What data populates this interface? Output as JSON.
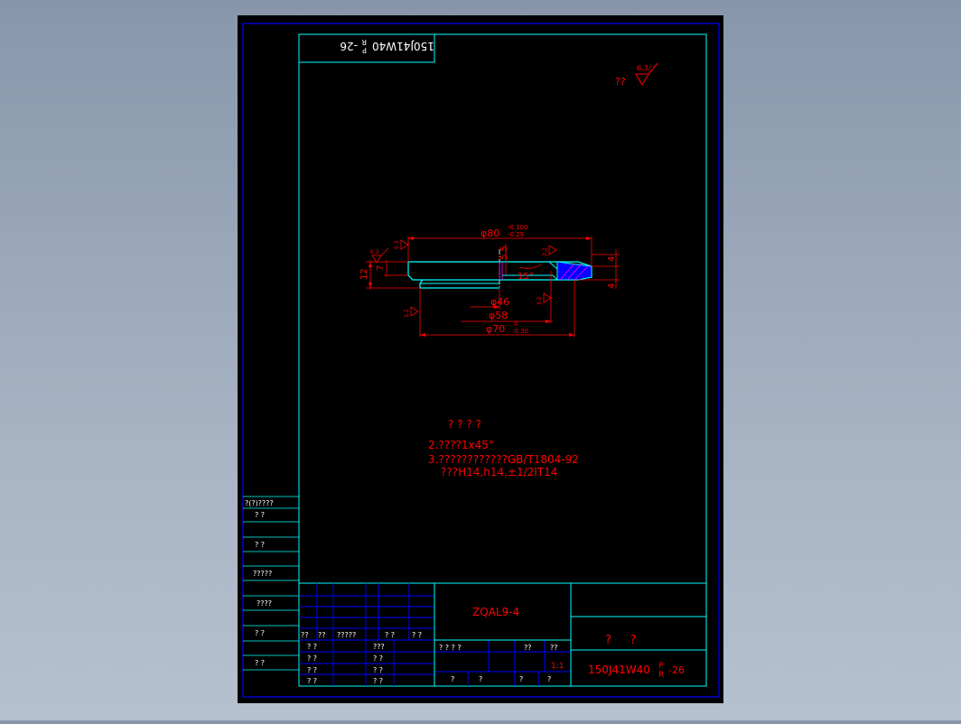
{
  "drawing": {
    "top_stamp": "150J41W40",
    "top_stamp_sup": "P",
    "top_stamp_sub": "R",
    "top_stamp_suffix": "-26",
    "roughness_general": {
      "prefix": "??",
      "value": "6.3/"
    }
  },
  "dimensions": {
    "d80": "φ80",
    "d80_tol_upper": "-0.100",
    "d80_tol_lower": "-0.29",
    "d46": "φ46",
    "d58": "φ58",
    "d70": "φ70",
    "d70_tol_upper": "0",
    "d70_tol_lower": "-0.30",
    "h12": "12",
    "h7": "7",
    "h5_5": "5.5",
    "angle15": "15°",
    "right4a": "4",
    "right4b": "4",
    "rough_left": "6.3",
    "rough_small_a": "6.3",
    "rough_small_b": "3.2",
    "rough_small_c": "3.2",
    "rough_small_d": "3.2"
  },
  "notes": {
    "heading": "? ? ? ?",
    "line2": "2.????1x45°",
    "line3": "3.????????????GB/T1804-92",
    "line4": "???H14,h14,±1/2IT14"
  },
  "left_column": {
    "title": "?(?)????",
    "rows": [
      "?  ?",
      "?  ?",
      "?????",
      "????",
      "?  ?",
      "?  ?"
    ]
  },
  "title_block": {
    "material": "ZQAL9-4",
    "name": "?     ?",
    "drawing_number": "150J41W40",
    "drawing_number_sup": "P",
    "drawing_number_sub": "R",
    "drawing_number_suffix": "-26",
    "scale": "1:1",
    "stage_label": "? ? ? ?",
    "weight_label": "??",
    "scale_label": "??",
    "sheet_a": "?",
    "sheet_b": "?",
    "sheet_c": "?",
    "sheet_d": "?",
    "rev_header": [
      "??",
      "??",
      "?????",
      "? ?",
      "? ?"
    ],
    "sign_rows": [
      {
        "a": "? ?",
        "b": "???"
      },
      {
        "a": "? ?",
        "b": "? ?"
      },
      {
        "a": "? ?",
        "b": "? ?"
      },
      {
        "a": "? ?",
        "b": "? ?"
      }
    ]
  },
  "colors": {
    "background": "#000000",
    "outer_border": "#0000ff",
    "frame_lines": "#00ffff",
    "table_lines": "#0000ff",
    "geometry": "#00ffff",
    "dimension_red": "#ff0000",
    "text_red": "#ff0000",
    "text_white": "#ffffff",
    "section_fill": "#0000ff",
    "hatch_magenta": "#ff00ff"
  }
}
